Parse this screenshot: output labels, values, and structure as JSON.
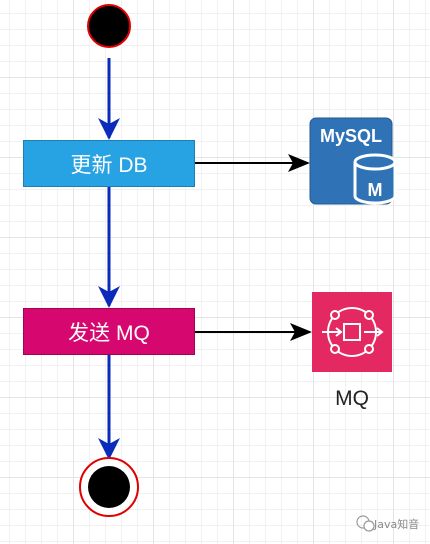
{
  "nodes": {
    "update_db": {
      "label": "更新 DB",
      "fill": "#27a2e2",
      "border": "#1f7fb3"
    },
    "send_mq": {
      "label": "发送 MQ",
      "fill": "#d6086f",
      "border": "#9e0652"
    }
  },
  "icons": {
    "mysql": {
      "name": "mysql-database-icon",
      "text": "MySQL",
      "badge": "M",
      "color": "#2f73b6"
    },
    "mq": {
      "name": "mq-service-icon",
      "caption": "MQ",
      "color": "#e32862"
    }
  },
  "colors": {
    "start_fill": "#000000",
    "start_stroke": "#e00000",
    "flow_arrow": "#0b2bba",
    "link_arrow": "#000000"
  },
  "watermark": {
    "text": "Java知音"
  }
}
